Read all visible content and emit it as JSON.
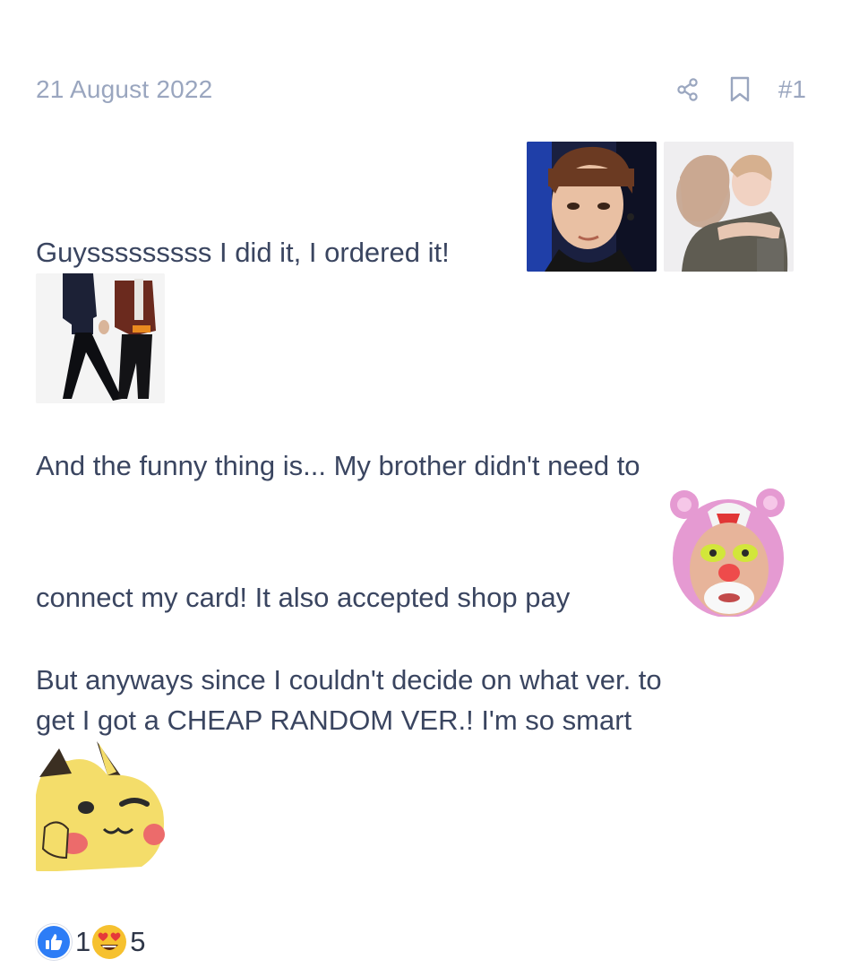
{
  "header": {
    "date": "21 August 2022",
    "post_number": "#1",
    "share_icon": "share-icon",
    "bookmark_icon": "bookmark-icon"
  },
  "body": {
    "line1": "Guysssssssss I did it, I ordered it!",
    "line2": "And the funny thing is... My brother didn't need to",
    "line3": "connect my card! It also accepted shop pay",
    "line4": "But anyways since I couldn't decide on what ver. to",
    "line5": "get I got a CHEAP RANDOM VER.! I'm so smart"
  },
  "images": [
    "gif-crying-woman",
    "gif-hug",
    "gif-walking-men",
    "sticker-pink-panther-hood",
    "sticker-pikachu-thinking"
  ],
  "reactions": [
    {
      "icon": "thumbs-up-icon",
      "count": "1",
      "color": "#2d7df6"
    },
    {
      "icon": "heart-eyes-icon",
      "count": "5",
      "color": "#f6c12f"
    }
  ],
  "colors": {
    "text": "#3a4560",
    "muted": "#9aa6bf",
    "background": "#ffffff"
  }
}
